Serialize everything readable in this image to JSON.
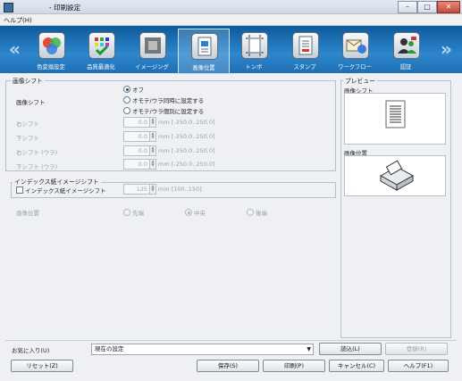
{
  "window": {
    "title": "- 印刷設定",
    "controls": {
      "minimize": "–",
      "maximize": "□",
      "close": "✕"
    }
  },
  "menu": {
    "help": "ヘルプ(H)"
  },
  "toolbar": {
    "left_arrow": "«",
    "right_arrow": "»",
    "items": [
      {
        "label": "色変換設定",
        "icon": "color-conversion-icon"
      },
      {
        "label": "品質最適化",
        "icon": "quality-optimize-icon"
      },
      {
        "label": "イメージング",
        "icon": "imaging-icon"
      },
      {
        "label": "画像位置",
        "icon": "image-position-icon"
      },
      {
        "label": "トンボ",
        "icon": "crop-marks-icon"
      },
      {
        "label": "スタンプ",
        "icon": "stamp-icon"
      },
      {
        "label": "ワークフロー",
        "icon": "workflow-icon"
      },
      {
        "label": "認証",
        "icon": "authentication-icon"
      }
    ],
    "selected": "画像位置"
  },
  "image_shift": {
    "group_label": "画像シフト",
    "field_label": "画像シフト",
    "options": [
      {
        "label": "オフ",
        "selected": true
      },
      {
        "label": "オモテ/ウラ同時に設定する",
        "selected": false
      },
      {
        "label": "オモテ/ウラ個別に設定する",
        "selected": false
      }
    ],
    "shifts": [
      {
        "label": "右シフト",
        "value": "0.0",
        "unit": "mm [-250.0..250.0]"
      },
      {
        "label": "下シフト",
        "value": "0.0",
        "unit": "mm [-250.0..250.0]"
      },
      {
        "label": "右シフト (ウラ)",
        "value": "0.0",
        "unit": "mm [-250.0..250.0]"
      },
      {
        "label": "下シフト (ウラ)",
        "value": "0.0",
        "unit": "mm [-250.0..250.0]"
      }
    ]
  },
  "index_shift": {
    "group_label": "インデックス紙イメージシフト",
    "checkbox_label": "インデックス紙イメージシフト",
    "checked": false,
    "value": "125",
    "unit": "mm [100..150]"
  },
  "image_position": {
    "label": "画像位置",
    "options": [
      {
        "label": "先端",
        "selected": false
      },
      {
        "label": "中央",
        "selected": true
      },
      {
        "label": "後端",
        "selected": false
      }
    ]
  },
  "preview": {
    "group_label": "プレビュー",
    "shift_label": "画像シフト",
    "position_label": "画像位置"
  },
  "favorites": {
    "label": "お気に入り(U)",
    "selected": "現在の設定",
    "load_button": "読込(L)",
    "register_button": "登録(R)"
  },
  "footer": {
    "reset": "リセット(Z)",
    "save": "保存(S)",
    "print": "印刷(P)",
    "cancel": "キャンセル(C)",
    "help": "ヘルプ(F1)"
  }
}
